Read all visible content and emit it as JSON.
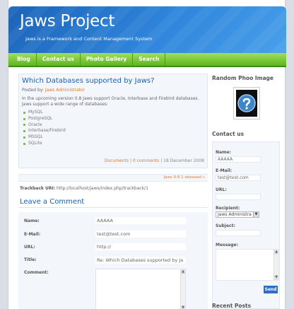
{
  "site": {
    "title": "Jaws Project",
    "tagline": "Jaws is a Framework and Content Management System"
  },
  "nav": {
    "items": [
      "Blog",
      "Contact us",
      "Photo Gallery",
      "Search"
    ]
  },
  "post": {
    "title": "Which Databases supported by Jaws?",
    "posted_by_label": "Posted by:",
    "author": "Jaws Administrator",
    "body": "In the upcoming version 0.8 Jaws support Oracle, Interbase and Firebird databases. Jaws support a wide range of databases:",
    "databases": [
      "MySQL",
      "PostgreSQL",
      "Oracle",
      "Interbase/Firebird",
      "MSSQL",
      "SQLite"
    ],
    "footer": {
      "category": "Documents",
      "comments": "0 comments",
      "separator": "|",
      "date": "18 December 2008"
    }
  },
  "release_link": "Jaws 0.8.1 released »",
  "trackback": {
    "label": "Trackback URI:",
    "uri": "http://localhost/jaws/index.php/trackback/1"
  },
  "comment_form": {
    "heading": "Leave a Comment",
    "name_label": "Name:",
    "name_value": "AAAAA",
    "email_label": "E-Mail:",
    "email_value": "test@test.com",
    "url_label": "URL:",
    "url_value": "http://",
    "title_label": "Title:",
    "title_value": "Re: Which Databases supported by Ja",
    "comment_label": "Comment:"
  },
  "sidebar": {
    "photo_title": "Random Phoo Image",
    "contact_title": "Contact us",
    "name_label": "Name:",
    "name_value": "AAAAA",
    "email_label": "E-Mail:",
    "email_value": "test@test.com",
    "url_label": "URL:",
    "recipient_label": "Recipient:",
    "recipient_value": "Jaws Administra",
    "subject_label": "Subject:",
    "message_label": "Message:",
    "send_label": "Send",
    "recent_posts_title": "Recent Posts"
  },
  "colors": {
    "header_blue": "#2f86dc",
    "nav_green": "#6cbf2a",
    "link_blue": "#1c5fae",
    "link_orange": "#e07a2d"
  },
  "icons": {
    "random_photo": "question-mark-icon",
    "list_bullet": "green-square-bullet-icon"
  }
}
